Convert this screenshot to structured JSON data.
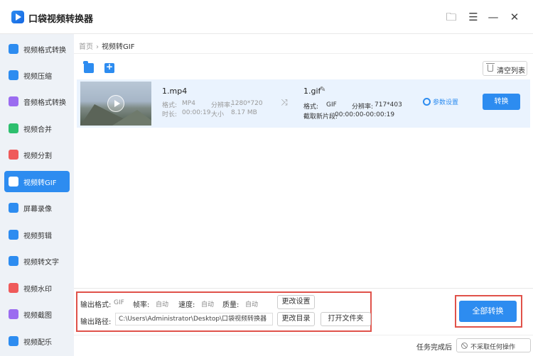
{
  "app": {
    "title": "口袋视频转换器"
  },
  "sidebar": {
    "items": [
      {
        "label": "视频格式转换",
        "color": "#2d8cf0"
      },
      {
        "label": "视频压缩",
        "color": "#2d8cf0"
      },
      {
        "label": "音频格式转换",
        "color": "#9b6cf0"
      },
      {
        "label": "视频合并",
        "color": "#2dbf6e"
      },
      {
        "label": "视频分割",
        "color": "#ef5a5a"
      },
      {
        "label": "视频转GIF",
        "color": "#ffffff",
        "active": true
      },
      {
        "label": "屏幕录像",
        "color": "#2d8cf0"
      },
      {
        "label": "视频剪辑",
        "color": "#2d8cf0"
      },
      {
        "label": "视频转文字",
        "color": "#2d8cf0"
      },
      {
        "label": "视频水印",
        "color": "#ef5a5a"
      },
      {
        "label": "视频截图",
        "color": "#9b6cf0"
      },
      {
        "label": "视频配乐",
        "color": "#2d8cf0"
      }
    ]
  },
  "breadcrumb": {
    "home": "首页",
    "separator": "›",
    "current": "视频转GIF"
  },
  "toolbar": {
    "clear_label": "清空列表"
  },
  "file": {
    "source_name": "1.mp4",
    "format_label": "格式:",
    "format_value": "MP4",
    "resolution_label": "分辨率:",
    "resolution_value": "1280*720",
    "duration_label": "时长:",
    "duration_value": "00:00:19",
    "size_label": "大小",
    "size_value": "8.17 MB",
    "target_name": "1.gif",
    "target_format_label": "格式:",
    "target_format_value": "GIF",
    "target_resolution_label": "分辨率:",
    "target_resolution_value": "717*403",
    "clip_label": "截取新片段:",
    "clip_value": "00:00:00-00:00:19",
    "settings_label": "参数设置",
    "convert_label": "转换"
  },
  "output": {
    "format_label": "输出格式:",
    "format_value": "GIF",
    "framerate_label": "帧率:",
    "framerate_value": "自动",
    "speed_label": "速度:",
    "speed_value": "自动",
    "quality_label": "质量:",
    "quality_value": "自动",
    "change_settings_label": "更改设置",
    "path_label": "输出路径:",
    "path_value": "C:\\Users\\Administrator\\Desktop\\口袋视频转换器",
    "change_dir_label": "更改目录",
    "open_folder_label": "打开文件夹",
    "convert_all_label": "全部转换"
  },
  "footer": {
    "after_label": "任务完成后",
    "after_value": "不采取任何操作"
  }
}
